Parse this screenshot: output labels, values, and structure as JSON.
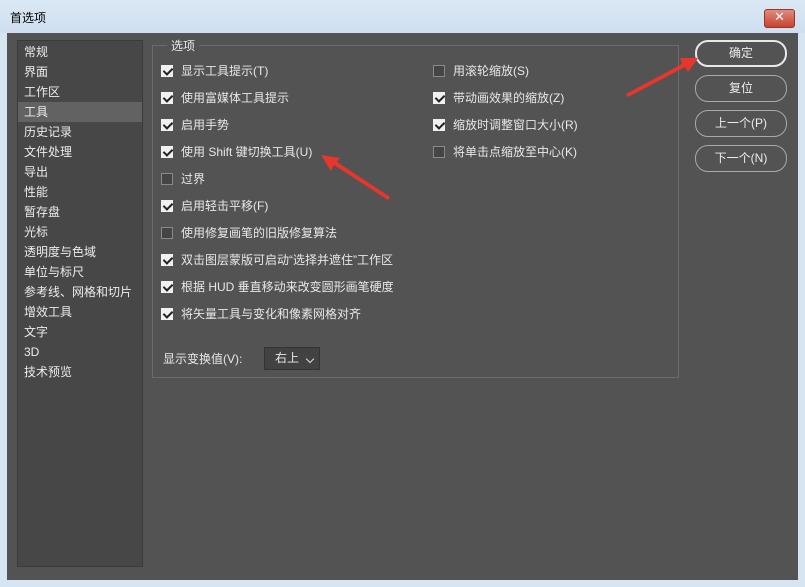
{
  "window": {
    "title": "首选项",
    "close_glyph": "✕"
  },
  "sidebar": {
    "selected_index": 3,
    "items": [
      "常规",
      "界面",
      "工作区",
      "工具",
      "历史记录",
      "文件处理",
      "导出",
      "性能",
      "暂存盘",
      "光标",
      "透明度与色域",
      "单位与标尺",
      "参考线、网格和切片",
      "增效工具",
      "文字",
      "3D",
      "技术预览"
    ]
  },
  "options": {
    "group_label": "选项",
    "left": [
      {
        "label": "显示工具提示(T)",
        "checked": true
      },
      {
        "label": "使用富媒体工具提示",
        "checked": true
      },
      {
        "label": "启用手势",
        "checked": true
      },
      {
        "label": "使用 Shift 键切换工具(U)",
        "checked": true
      },
      {
        "label": "过界",
        "checked": false
      },
      {
        "label": "启用轻击平移(F)",
        "checked": true
      },
      {
        "label": "使用修复画笔的旧版修复算法",
        "checked": false
      },
      {
        "label": "双击图层蒙版可启动“选择并遮住”工作区",
        "checked": true
      },
      {
        "label": "根据 HUD 垂直移动来改变圆形画笔硬度",
        "checked": true
      },
      {
        "label": "将矢量工具与变化和像素网格对齐",
        "checked": true
      }
    ],
    "right": [
      {
        "label": "用滚轮缩放(S)",
        "checked": false
      },
      {
        "label": "带动画效果的缩放(Z)",
        "checked": true
      },
      {
        "label": "缩放时调整窗口大小(R)",
        "checked": true
      },
      {
        "label": "将单击点缩放至中心(K)",
        "checked": false
      }
    ],
    "display_transform_label": "显示变换值(V):",
    "display_transform_value": "右上"
  },
  "buttons": {
    "ok": "确定",
    "reset": "复位",
    "prev": "上一个(P)",
    "next": "下一个(N)"
  },
  "colors": {
    "background": "#535353",
    "sidebar": "#474747",
    "selected": "#626262",
    "arrow": "#e8362c"
  }
}
